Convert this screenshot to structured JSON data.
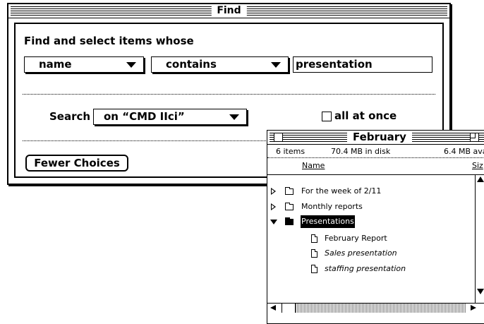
{
  "find_window": {
    "title": "Find",
    "heading": "Find and select items whose",
    "attribute_popup": "name",
    "operator_popup": "contains",
    "search_text": "presentation",
    "search_label": "Search",
    "search_location_popup": "on “CMD IIci”",
    "all_at_once_label": "all at once",
    "all_at_once_checked": false,
    "fewer_choices_label": "Fewer Choices"
  },
  "february_window": {
    "title": "February",
    "item_count": "6 items",
    "disk_usage": "70.4 MB in disk",
    "available": "6.4 MB ava",
    "col_name": "Name",
    "col_size": "Siz",
    "items": [
      {
        "label": "For the week of 2/11",
        "kind": "folder",
        "expanded": false
      },
      {
        "label": "Monthly reports",
        "kind": "folder",
        "expanded": false
      },
      {
        "label": "Presentations",
        "kind": "folder",
        "expanded": true,
        "selected": true
      },
      {
        "label": "February Report",
        "kind": "document"
      },
      {
        "label": "Sales presentation",
        "kind": "document"
      },
      {
        "label": "staffing presentation",
        "kind": "document"
      }
    ]
  }
}
